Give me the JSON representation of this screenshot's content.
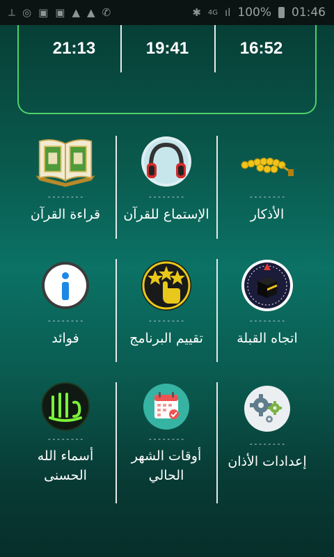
{
  "statusbar": {
    "network": "4G",
    "signal_label": "ıl",
    "battery_percent": "100%",
    "clock": "01:46"
  },
  "prayer_times": [
    "21:13",
    "19:41",
    "16:52"
  ],
  "separator": "--------",
  "tiles": [
    {
      "label": "قراءة القرآن",
      "icon": "quran-book-icon"
    },
    {
      "label": "الإستماع للقرآن",
      "icon": "headphones-icon"
    },
    {
      "label": "الأذكار",
      "icon": "prayer-beads-icon"
    },
    {
      "label": "فوائد",
      "icon": "info-icon"
    },
    {
      "label": "تقييم البرنامج",
      "icon": "rate-stars-icon"
    },
    {
      "label": "اتجاه القبلة",
      "icon": "qibla-compass-icon"
    },
    {
      "label": "أسماء الله الحسنى",
      "icon": "allah-calligraphy-icon"
    },
    {
      "label": "أوقات الشهر الحالي",
      "icon": "calendar-icon"
    },
    {
      "label": "إعدادات الأذان",
      "icon": "settings-gears-icon"
    }
  ],
  "colors": {
    "accent_green": "#4fd16a",
    "gold": "#d4b21e",
    "teal_circle": "#36b3a2"
  }
}
